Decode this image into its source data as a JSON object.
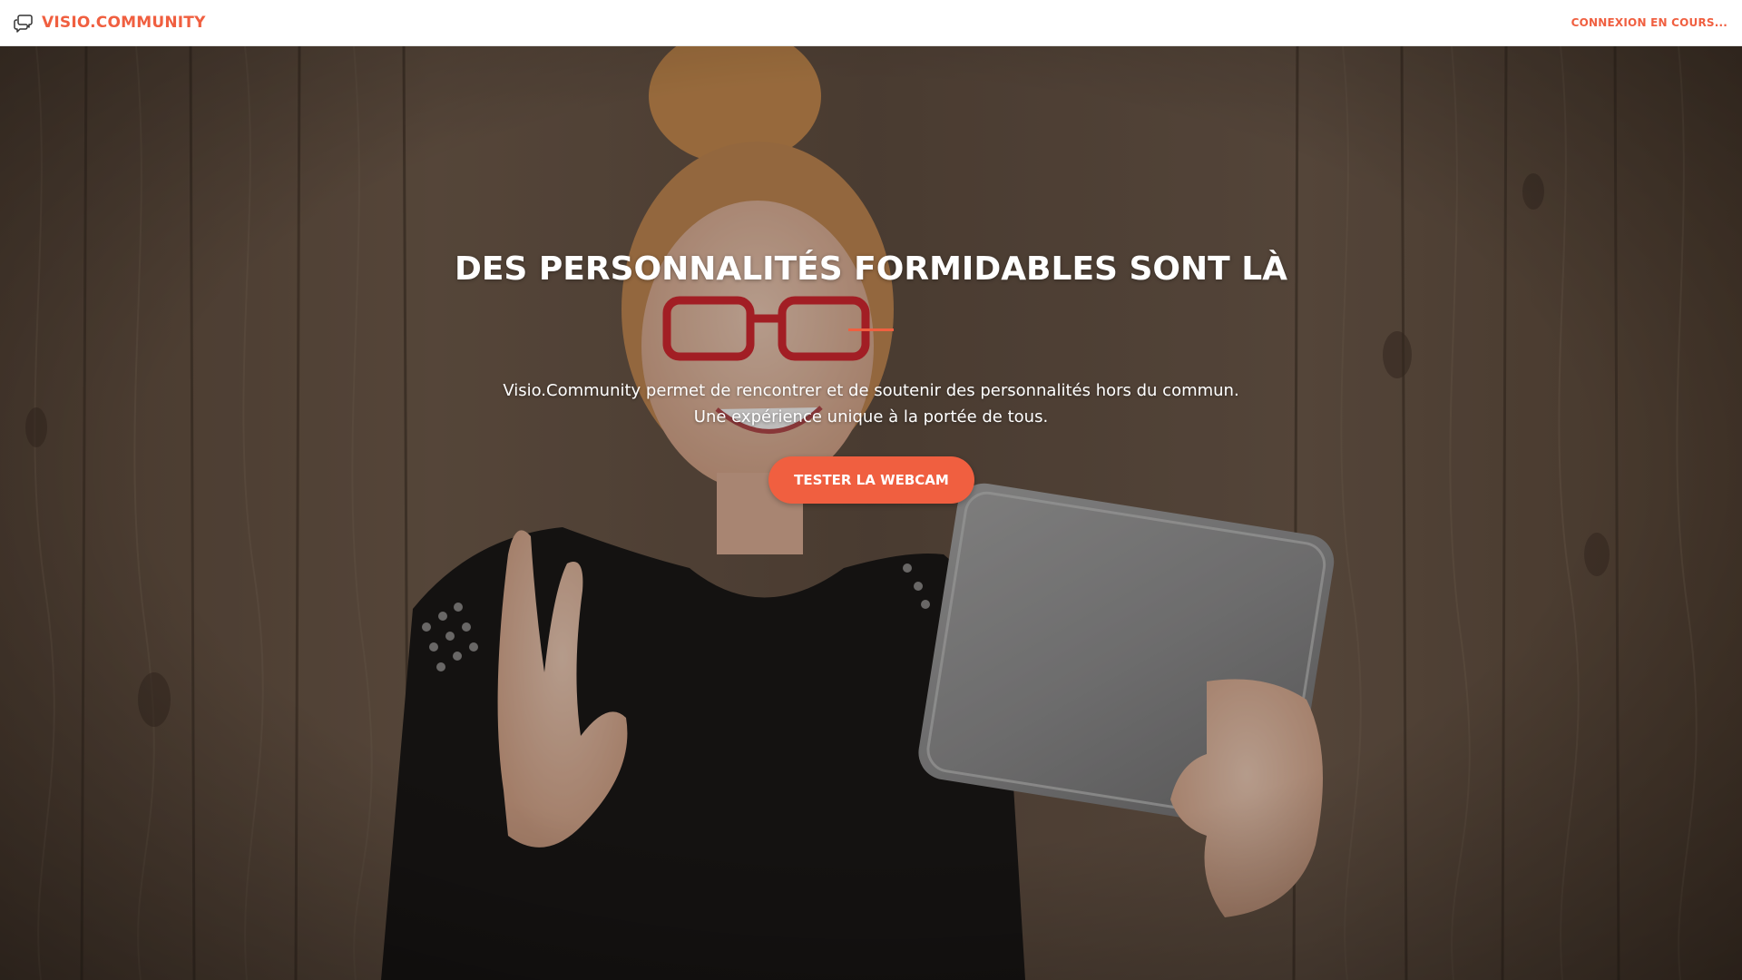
{
  "navbar": {
    "brand_icon": "chat-bubbles-icon",
    "brand_name": "VISIO.COMMUNITY",
    "status_link": "CONNEXION EN COURS..."
  },
  "hero": {
    "title": "DES PERSONNALITÉS FORMIDABLES SONT LÀ",
    "text_line_1": "Visio.Community permet de rencontrer et de soutenir des personnalités hors du commun.",
    "text_line_2": "Une expérience unique à la portée de tous.",
    "cta_label": "TESTER LA WEBCAM"
  },
  "colors": {
    "accent": "#f05f40",
    "navbar_bg": "#ffffff",
    "hero_text": "#ffffff"
  }
}
